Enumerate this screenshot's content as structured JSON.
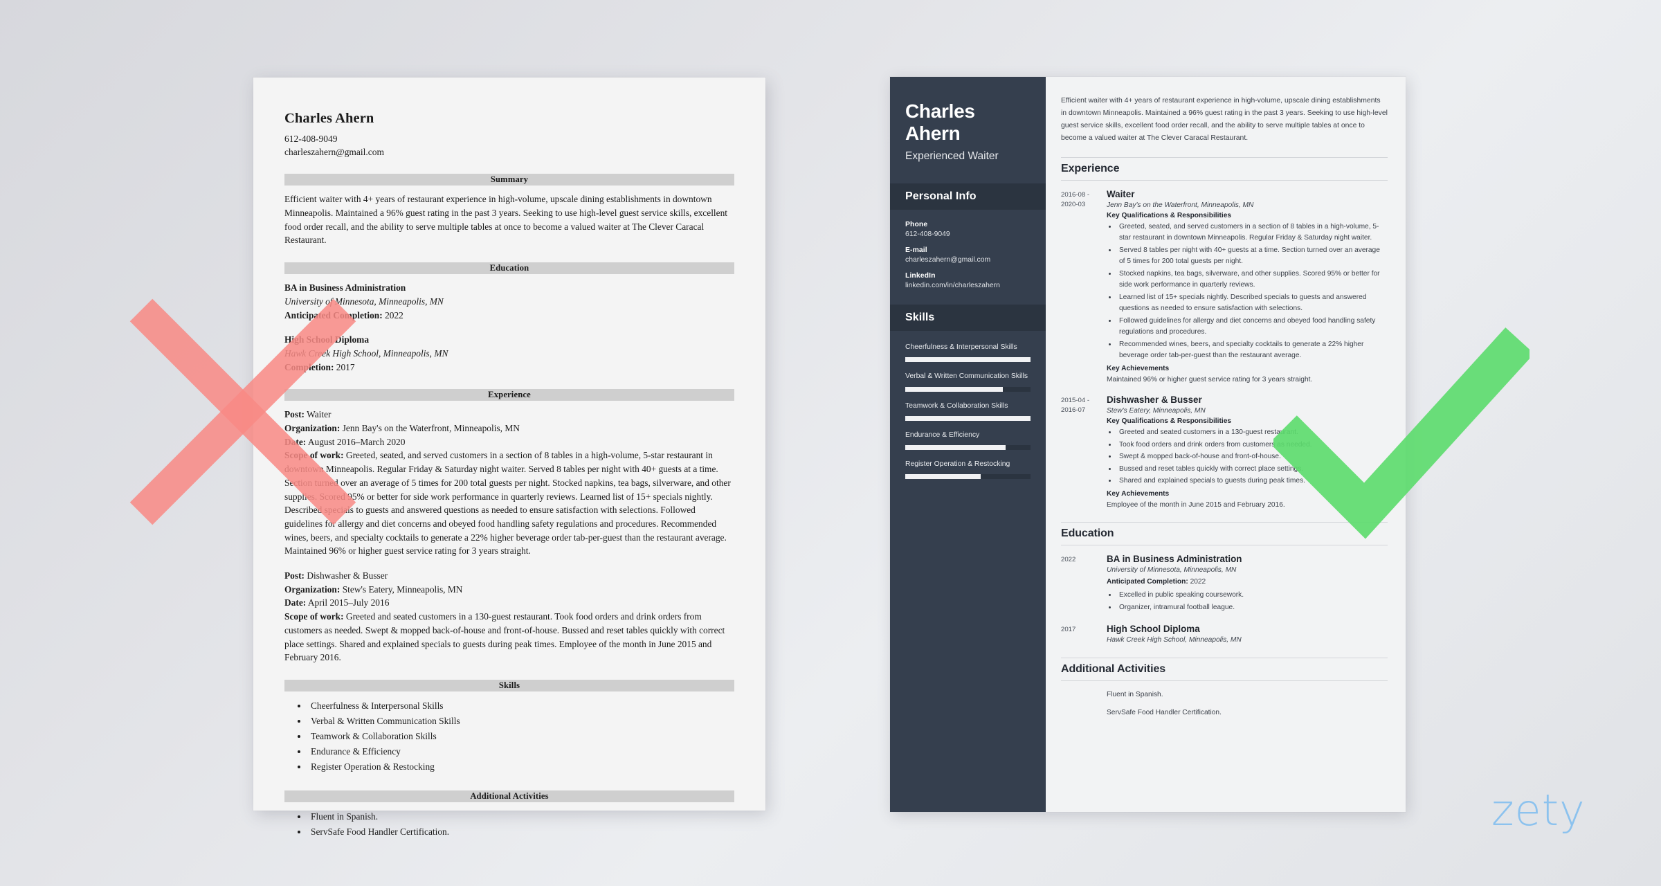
{
  "candidate": {
    "name": "Charles Ahern",
    "phone": "612-408-9049",
    "email": "charleszahern@gmail.com",
    "linkedin": "linkedin.com/in/charleszahern",
    "role": "Experienced Waiter"
  },
  "bad_resume": {
    "name": "Charles Ahern",
    "phone": "612-408-9049",
    "email": "charleszahern@gmail.com",
    "sections": {
      "summary": "Summary",
      "education": "Education",
      "experience": "Experience",
      "skills": "Skills",
      "additional": "Additional Activities"
    },
    "summary_text": "Efficient waiter with 4+ years of restaurant experience in high-volume, upscale dining establishments in downtown Minneapolis. Maintained a 96% guest rating in the past 3 years. Seeking to use high-level guest service skills, excellent food order recall, and the ability to serve multiple tables at once to become a valued waiter at The Clever Caracal Restaurant.",
    "education": [
      {
        "degree": "BA in Business Administration",
        "school": "University of Minnesota, Minneapolis, MN",
        "completion_label": "Anticipated Completion:",
        "completion_value": "2022"
      },
      {
        "degree": "High School Diploma",
        "school": "Hawk Creek High School, Minneapolis, MN",
        "completion_label": "Completion:",
        "completion_value": "2017"
      }
    ],
    "labels": {
      "post": "Post:",
      "organization": "Organization:",
      "date": "Date:",
      "scope": "Scope of work:"
    },
    "experience": [
      {
        "post": "Waiter",
        "organization": "Jenn Bay's on the Waterfront, Minneapolis, MN",
        "date": "August 2016–March 2020",
        "scope": "Greeted, seated, and served customers in a section of 8 tables in a high-volume, 5-star restaurant in downtown Minneapolis. Regular Friday & Saturday night waiter. Served 8 tables per night with 40+ guests at a time. Section turned over an average of 5 times for 200 total guests per night. Stocked napkins, tea bags, silverware, and other supplies. Scored 95% or better for side work performance in quarterly reviews. Learned list of 15+ specials nightly. Described specials to guests and answered questions as needed to ensure satisfaction with selections. Followed guidelines for allergy and diet concerns and obeyed food handling safety regulations and procedures. Recommended wines, beers, and specialty cocktails to generate a 22% higher beverage order tab-per-guest than the restaurant average. Maintained 96% or higher guest service rating for 3 years straight."
      },
      {
        "post": "Dishwasher & Busser",
        "organization": "Stew's Eatery, Minneapolis, MN",
        "date": "April 2015–July 2016",
        "scope": "Greeted and seated customers in a 130-guest restaurant. Took food orders and drink orders from customers as needed. Swept & mopped back-of-house and front-of-house. Bussed and reset tables quickly with correct place settings. Shared and explained specials to guests during peak times. Employee of the month in June 2015 and February 2016."
      }
    ],
    "skills": [
      "Cheerfulness & Interpersonal Skills",
      "Verbal & Written Communication Skills",
      "Teamwork & Collaboration Skills",
      "Endurance & Efficiency",
      "Register Operation & Restocking"
    ],
    "additional": [
      "Fluent in Spanish.",
      "ServSafe Food Handler Certification."
    ]
  },
  "good_resume": {
    "sidebar": {
      "name_line1": "Charles",
      "name_line2": "Ahern",
      "role": "Experienced Waiter",
      "personal_info_title": "Personal Info",
      "personal_info": [
        {
          "label": "Phone",
          "value": "612-408-9049"
        },
        {
          "label": "E-mail",
          "value": "charleszahern@gmail.com"
        },
        {
          "label": "LinkedIn",
          "value": "linkedin.com/in/charleszahern"
        }
      ],
      "skills_title": "Skills",
      "skills": [
        {
          "name": "Cheerfulness & Interpersonal Skills",
          "level": 100
        },
        {
          "name": "Verbal & Written Communication Skills",
          "level": 78
        },
        {
          "name": "Teamwork & Collaboration Skills",
          "level": 100
        },
        {
          "name": "Endurance & Efficiency",
          "level": 80
        },
        {
          "name": "Register Operation & Restocking",
          "level": 60
        }
      ]
    },
    "summary_text": "Efficient waiter with 4+ years of restaurant experience in high-volume, upscale dining establishments in downtown Minneapolis. Maintained a 96% guest rating in the past 3 years. Seeking to use high-level guest service skills, excellent food order recall, and the ability to serve multiple tables at once to become a valued waiter at The Clever Caracal Restaurant.",
    "sections": {
      "experience": "Experience",
      "education": "Education",
      "additional": "Additional Activities"
    },
    "labels": {
      "key_quals": "Key Qualifications & Responsibilities",
      "key_achievements": "Key Achievements",
      "anticipated_completion": "Anticipated Completion:"
    },
    "experience": [
      {
        "date_from": "2016-08 -",
        "date_to": "2020-03",
        "title": "Waiter",
        "org": "Jenn Bay's on the Waterfront, Minneapolis, MN",
        "bullets": [
          "Greeted, seated, and served customers in a section of 8 tables in a high-volume, 5-star restaurant in downtown Minneapolis. Regular Friday & Saturday night waiter.",
          "Served 8 tables per night with 40+ guests at a time. Section turned over an average of 5 times for 200 total guests per night.",
          "Stocked napkins, tea bags, silverware, and other supplies. Scored 95% or better for side work performance in quarterly reviews.",
          "Learned list of 15+ specials nightly. Described specials to guests and answered questions as needed to ensure satisfaction with selections.",
          "Followed guidelines for allergy and diet concerns and obeyed food handling safety regulations and procedures.",
          "Recommended wines, beers, and specialty cocktails to generate a 22% higher beverage order tab-per-guest than the restaurant average."
        ],
        "achievement": "Maintained 96% or higher guest service rating for 3 years straight."
      },
      {
        "date_from": "2015-04 -",
        "date_to": "2016-07",
        "title": "Dishwasher & Busser",
        "org": "Stew's Eatery, Minneapolis, MN",
        "bullets": [
          "Greeted and seated customers in a 130-guest restaurant.",
          "Took food orders and drink orders from customers as needed.",
          "Swept & mopped back-of-house and front-of-house.",
          "Bussed and reset tables quickly with correct place settings.",
          "Shared and explained specials to guests during peak times."
        ],
        "achievement": "Employee of the month in June 2015 and February 2016."
      }
    ],
    "education": [
      {
        "date": "2022",
        "degree": "BA in Business Administration",
        "school": "University of Minnesota, Minneapolis, MN",
        "completion_label": "Anticipated Completion:",
        "completion_value": "2022",
        "bullets": [
          "Excelled in public speaking coursework.",
          "Organizer, intramural football league."
        ]
      },
      {
        "date": "2017",
        "degree": "High School Diploma",
        "school": "Hawk Creek High School, Minneapolis, MN",
        "completion_label": "",
        "completion_value": "",
        "bullets": []
      }
    ],
    "additional": [
      "Fluent in Spanish.",
      "ServSafe Food Handler Certification."
    ]
  },
  "marks": {
    "reject_color": "#f98a85",
    "approve_color": "#5bdc6c"
  },
  "brand": {
    "logo_text": "zety",
    "logo_color": "#8cc2ee"
  }
}
